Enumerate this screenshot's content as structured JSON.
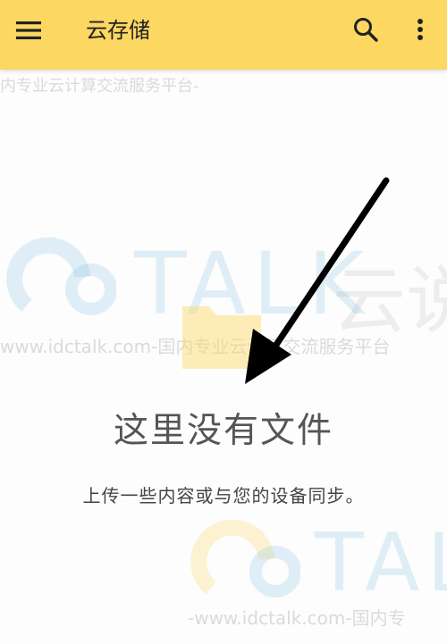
{
  "app_bar": {
    "title": "云存储",
    "menu_icon": "menu-icon",
    "search_icon": "search-icon",
    "more_icon": "more-vert-icon",
    "background_color": "#fcd762"
  },
  "empty_state": {
    "icon": "folder-icon",
    "title": "这里没有文件",
    "subtitle": "上传一些内容或与您的设备同步。"
  },
  "watermark": {
    "brand": "TALK",
    "brand_cn": "云说",
    "slogan_top": "内专业云计算交流服务平台-",
    "slogan_mid": "www.idctalk.com-国内专业云计算交流服务平台",
    "slogan_bottom": "-www.idctalk.com-国内专"
  },
  "colors": {
    "accent": "#fcd762",
    "arrow": "#000000",
    "text_primary": "#555555",
    "text_secondary": "#444444"
  }
}
